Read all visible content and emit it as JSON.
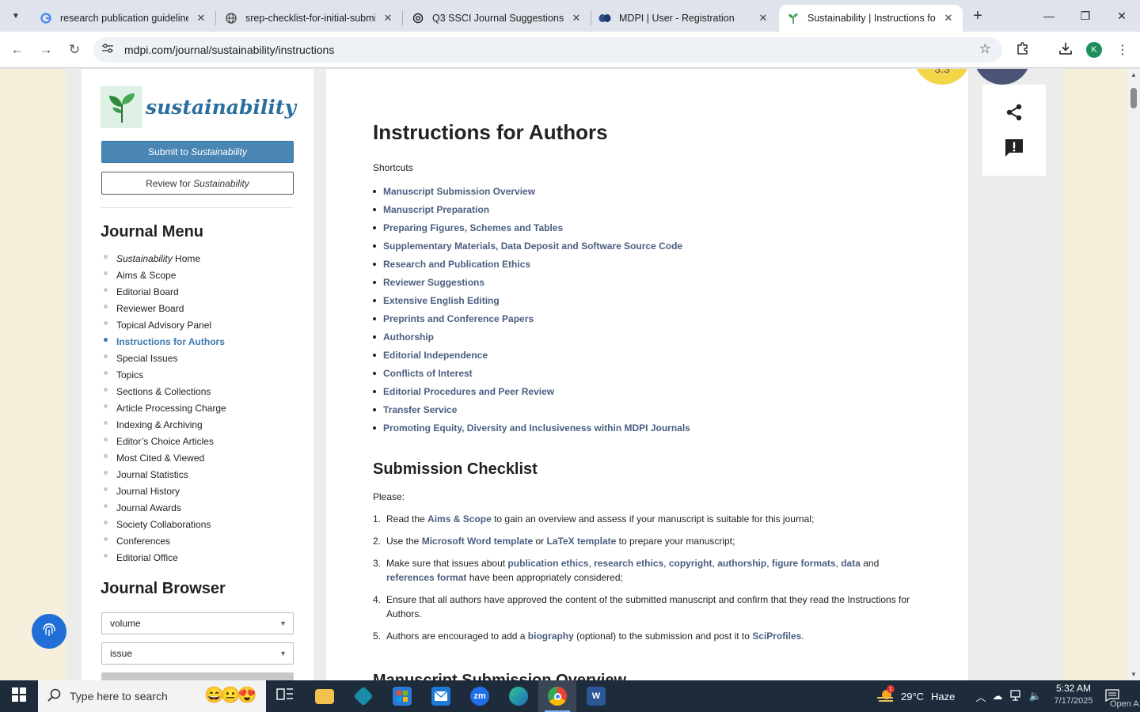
{
  "browser": {
    "tabs": [
      {
        "title": "research publication guidelines",
        "favicon": "google-g-icon"
      },
      {
        "title": "srep-checklist-for-initial-submi",
        "favicon": "globe-icon"
      },
      {
        "title": "Q3 SSCI Journal Suggestions",
        "favicon": "openai-icon"
      },
      {
        "title": "MDPI | User - Registration",
        "favicon": "mdpi-icon"
      },
      {
        "title": "Sustainability | Instructions for A",
        "favicon": "sustainability-leaf-icon",
        "active": true
      }
    ],
    "url": "mdpi.com/journal/sustainability/instructions",
    "profile_initial": "K"
  },
  "sidebar": {
    "logo_text": "sustainability",
    "submit_prefix": "Submit to ",
    "submit_journal": "Sustainability",
    "review_prefix": "Review for ",
    "review_journal": "Sustainability",
    "journal_menu_heading": "Journal Menu",
    "menu_home_journal": "Sustainability",
    "menu_home_suffix": " Home",
    "menu": [
      "Aims & Scope",
      "Editorial Board",
      "Reviewer Board",
      "Topical Advisory Panel",
      "Instructions for Authors",
      "Special Issues",
      "Topics",
      "Sections & Collections",
      "Article Processing Charge",
      "Indexing & Archiving",
      "Editor’s Choice Articles",
      "Most Cited & Viewed",
      "Journal Statistics",
      "Journal History",
      "Journal Awards",
      "Society Collaborations",
      "Conferences",
      "Editorial Office"
    ],
    "active_menu_item": "Instructions for Authors",
    "journal_browser_heading": "Journal Browser",
    "volume_select": "volume",
    "issue_select": "issue"
  },
  "main": {
    "title": "Instructions for Authors",
    "shortcuts_label": "Shortcuts",
    "shortcuts": [
      "Manuscript Submission Overview",
      "Manuscript Preparation",
      "Preparing Figures, Schemes and Tables",
      "Supplementary Materials, Data Deposit and Software Source Code",
      "Research and Publication Ethics",
      "Reviewer Suggestions",
      "Extensive English Editing",
      "Preprints and Conference Papers",
      "Authorship",
      "Editorial Independence",
      "Conflicts of Interest",
      "Editorial Procedures and Peer Review",
      "Transfer Service",
      "Promoting Equity, Diversity and Inclusiveness within MDPI Journals"
    ],
    "checklist_heading": "Submission Checklist",
    "please": "Please:",
    "checklist": {
      "item1": {
        "num": "1.",
        "a": "Read the ",
        "link1": "Aims & Scope",
        "b": " to gain an overview and assess if your manuscript is suitable for this journal;"
      },
      "item2": {
        "num": "2.",
        "a": "Use the ",
        "link1": "Microsoft Word template",
        "b": " or ",
        "link2": "LaTeX template",
        "c": " to prepare your manuscript;"
      },
      "item3": {
        "num": "3.",
        "a": "Make sure that issues about ",
        "link1": "publication ethics",
        "s1": ", ",
        "link2": "research ethics",
        "s2": ", ",
        "link3": "copyright",
        "s3": ", ",
        "link4": "authorship",
        "s4": ", ",
        "link5": "figure formats",
        "s5": ", ",
        "link6": "data",
        "s6": " and ",
        "link7": "references format",
        "b": " have been appropriately considered;"
      },
      "item4": {
        "num": "4.",
        "text": "Ensure that all authors have approved the content of the submitted manuscript and confirm that they read the Instructions for Authors."
      },
      "item5": {
        "num": "5.",
        "a": "Authors are encouraged to add a ",
        "link1": "biography",
        "b": " (optional) to the submission and post it to ",
        "link2": "SciProfiles",
        "c": "."
      }
    },
    "next_heading": "Manuscript Submission Overview",
    "badge_value": "3.3"
  },
  "taskbar": {
    "search_placeholder": "Type here to search",
    "weather_temp": "29°C",
    "weather_desc": "Haze",
    "weather_badge": "1",
    "time": "5:32 AM",
    "date": "7/17/2025",
    "notification_label": "Open A"
  },
  "colors": {
    "link": "#4b5e80",
    "active_menu": "#3a7ab0",
    "submit_button": "#4a86b4",
    "logo_text": "#2a6f9e",
    "taskbar": "#1d2b3a"
  }
}
